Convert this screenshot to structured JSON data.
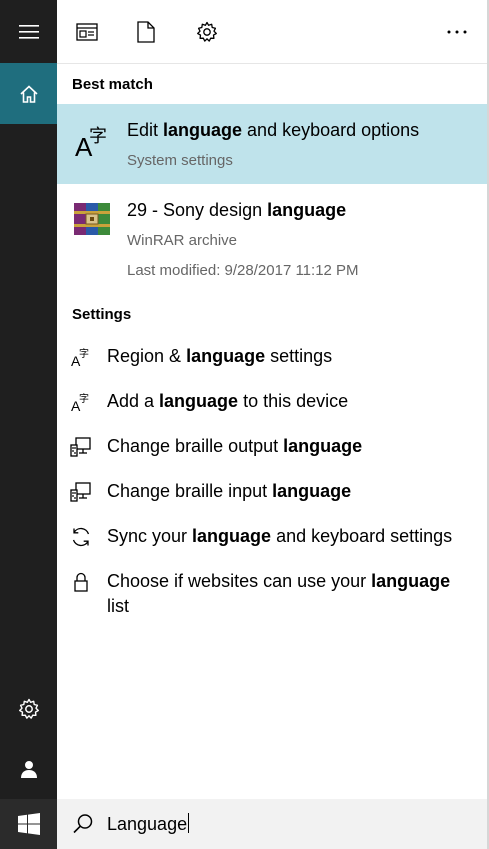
{
  "rail": {
    "menu_icon": "hamburger-menu-icon",
    "home_icon": "home-icon",
    "settings_icon": "gear-icon",
    "user_icon": "user-icon",
    "start_icon": "windows-logo-icon"
  },
  "topbar": {
    "apps_icon": "apps-filter-icon",
    "documents_icon": "document-filter-icon",
    "settings_icon": "settings-filter-icon",
    "more_icon": "more-options-icon"
  },
  "best_match": {
    "header": "Best match",
    "title_pre": "Edit ",
    "title_bold": "language",
    "title_post": " and keyboard options",
    "subtitle": "System settings"
  },
  "file_result": {
    "title_pre": "29 - Sony design ",
    "title_bold": "language",
    "type": "WinRAR archive",
    "modified": "Last modified: 9/28/2017 11:12 PM"
  },
  "settings": {
    "header": "Settings",
    "items": [
      {
        "pre": "Region & ",
        "bold": "language",
        "post": " settings"
      },
      {
        "pre": "Add a ",
        "bold": "language",
        "post": " to this device"
      },
      {
        "pre": "Change braille output ",
        "bold": "language",
        "post": ""
      },
      {
        "pre": "Change braille input ",
        "bold": "language",
        "post": ""
      },
      {
        "pre": "Sync your ",
        "bold": "language",
        "post": " and keyboard settings"
      },
      {
        "pre": "Choose if websites can use your ",
        "bold": "language",
        "post": "",
        "line2": "list"
      }
    ]
  },
  "search": {
    "value": "Language"
  }
}
